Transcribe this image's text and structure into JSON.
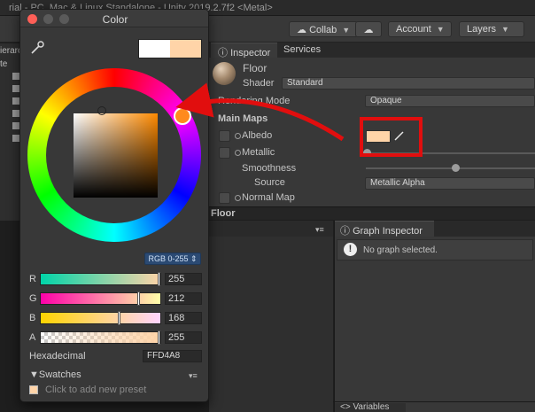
{
  "unity": {
    "title": "rial - PC, Mac & Linux Standalone - Unity 2019.2.7f2 <Metal>",
    "toolbar": {
      "collab": "Collab",
      "account": "Account",
      "layers": "Layers"
    },
    "hierarchy": {
      "label": "ierarch",
      "tab_e": "te"
    },
    "inspector_tabs": {
      "inspector": "Inspector",
      "services": "Services"
    },
    "material": {
      "name": "Floor",
      "shader_label": "Shader",
      "shader_value": "Standard",
      "rendering_mode_label": "Rendering Mode",
      "rendering_mode_value": "Opaque",
      "main_maps": "Main Maps",
      "albedo": "Albedo",
      "metallic": "Metallic",
      "smoothness": "Smoothness",
      "source_label": "Source",
      "source_value": "Metallic Alpha",
      "normal_map": "Normal Map",
      "albedo_color": "#ffd4a8"
    },
    "floor_bar": "Floor",
    "graph_inspector": {
      "tab": "Graph Inspector",
      "message": "No graph selected."
    },
    "variables_tab": "<> Variables"
  },
  "color_picker": {
    "title": "Color",
    "mode": "RGB 0-255 ⇕",
    "channels": [
      {
        "label": "R",
        "value": "255",
        "fraction": 1.0
      },
      {
        "label": "G",
        "value": "212",
        "fraction": 0.831
      },
      {
        "label": "B",
        "value": "168",
        "fraction": 0.659
      },
      {
        "label": "A",
        "value": "255",
        "fraction": 1.0
      }
    ],
    "hex_label": "Hexadecimal",
    "hex_value": "FFD4A8",
    "swatches_title": "Swatches",
    "swatches_hint": "Click to add new preset",
    "current_color": "#ffd4a8",
    "previous_color": "#ffffff"
  },
  "colors": {
    "highlight": "#e10e0e",
    "accent_blue": "#2b4a73"
  }
}
